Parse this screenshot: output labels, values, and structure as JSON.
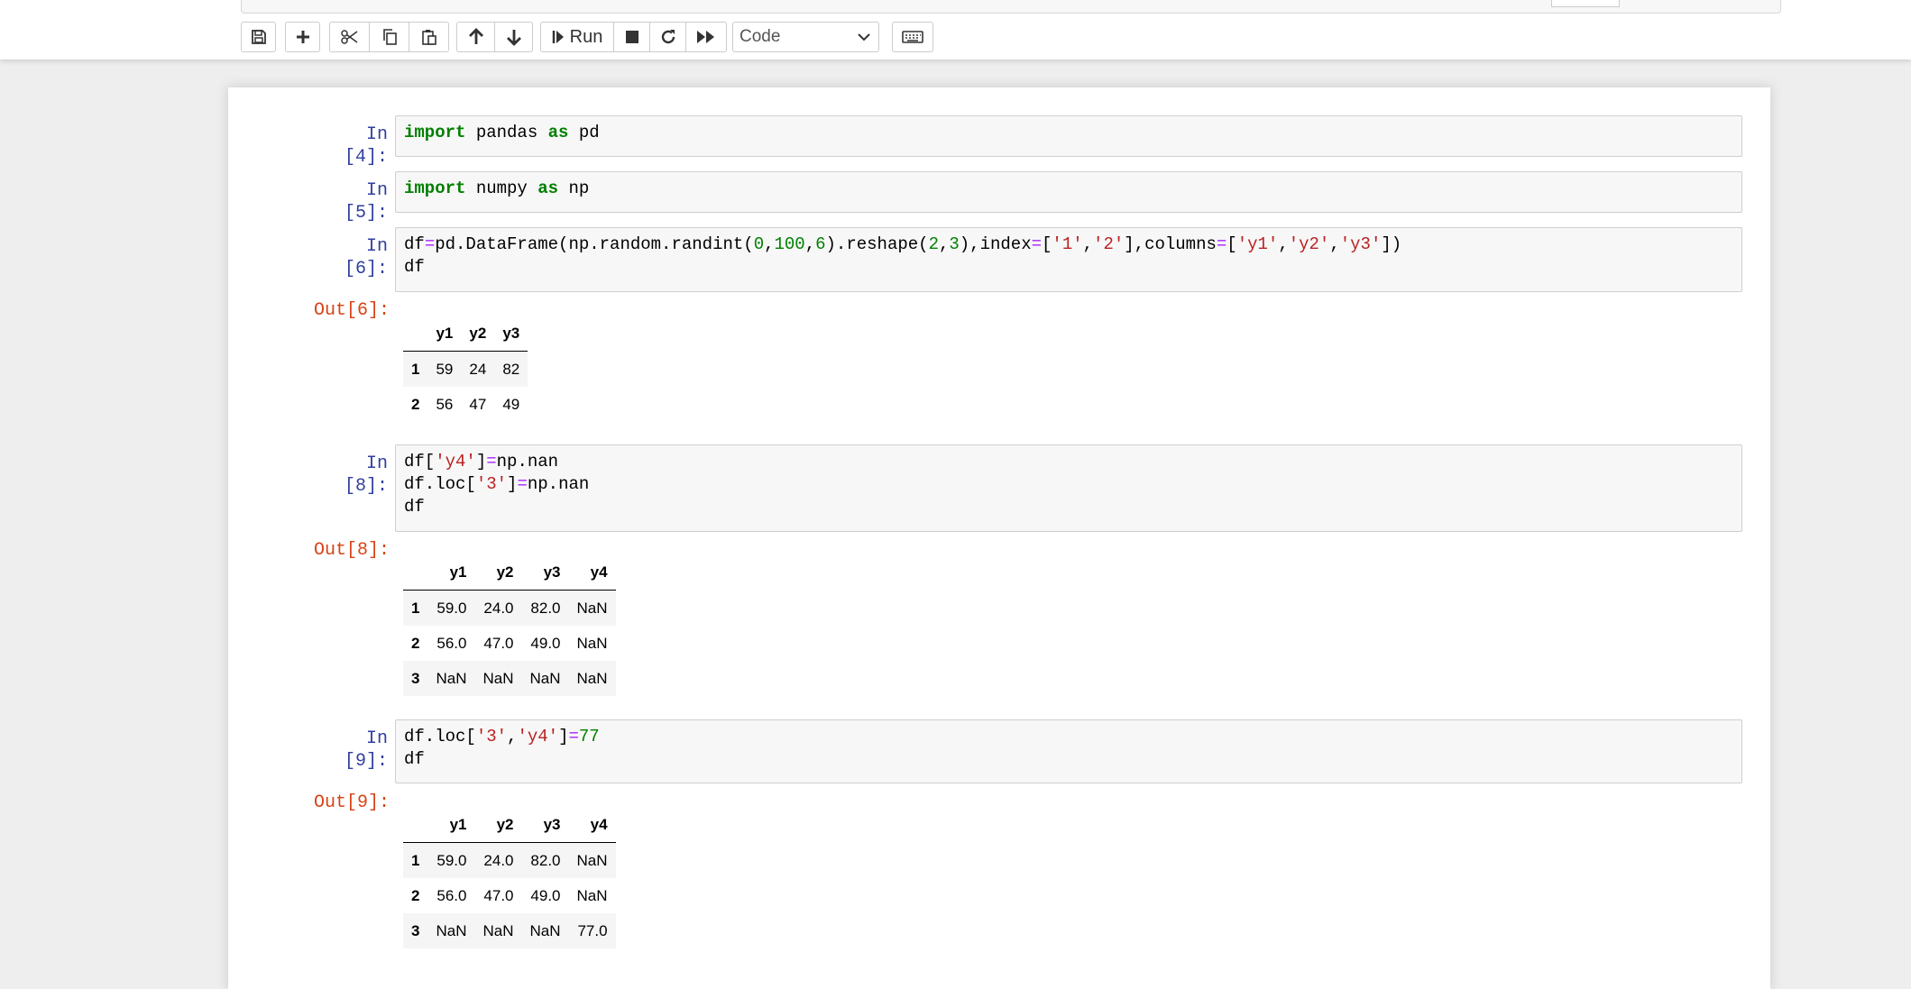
{
  "toolbar": {
    "run_label": "Run",
    "cell_type": "Code",
    "buttons": [
      "save-icon",
      "plus-icon",
      "scissors-icon",
      "copy-icon",
      "paste-icon",
      "arrow-up-icon",
      "arrow-down-icon",
      "step-forward-icon",
      "stop-icon",
      "refresh-icon",
      "fast-forward-icon",
      "keyboard-icon"
    ]
  },
  "cells": {
    "c4": {
      "prompt": "In [4]:"
    },
    "c5": {
      "prompt": "In [5]:"
    },
    "c6": {
      "prompt": "In [6]:",
      "out_prompt": "Out[6]:"
    },
    "c8": {
      "prompt": "In [8]:",
      "out_prompt": "Out[8]:"
    },
    "c9": {
      "prompt": "In [9]:",
      "out_prompt": "Out[9]:"
    }
  },
  "code": {
    "c4": [
      [
        [
          "kw",
          "import"
        ],
        [
          "t",
          " pandas "
        ],
        [
          "kw",
          "as"
        ],
        [
          "t",
          " pd"
        ]
      ]
    ],
    "c5": [
      [
        [
          "kw",
          "import"
        ],
        [
          "t",
          " numpy "
        ],
        [
          "kw",
          "as"
        ],
        [
          "t",
          " np"
        ]
      ]
    ],
    "c6": [
      [
        [
          "t",
          "df"
        ],
        [
          "op",
          "="
        ],
        [
          "t",
          "pd.DataFrame(np.random.randint("
        ],
        [
          "num",
          "0"
        ],
        [
          "t",
          ","
        ],
        [
          "num",
          "100"
        ],
        [
          "t",
          ","
        ],
        [
          "num",
          "6"
        ],
        [
          "t",
          ").reshape("
        ],
        [
          "num",
          "2"
        ],
        [
          "t",
          ","
        ],
        [
          "num",
          "3"
        ],
        [
          "t",
          "),index"
        ],
        [
          "op",
          "="
        ],
        [
          "t",
          "["
        ],
        [
          "str",
          "'1'"
        ],
        [
          "t",
          ","
        ],
        [
          "str",
          "'2'"
        ],
        [
          "t",
          "],columns"
        ],
        [
          "op",
          "="
        ],
        [
          "t",
          "["
        ],
        [
          "str",
          "'y1'"
        ],
        [
          "t",
          ","
        ],
        [
          "str",
          "'y2'"
        ],
        [
          "t",
          ","
        ],
        [
          "str",
          "'y3'"
        ],
        [
          "t",
          "])"
        ]
      ],
      [
        [
          "t",
          "df"
        ]
      ]
    ],
    "c8": [
      [
        [
          "t",
          "df["
        ],
        [
          "str",
          "'y4'"
        ],
        [
          "t",
          "]"
        ],
        [
          "op",
          "="
        ],
        [
          "t",
          "np.nan"
        ]
      ],
      [
        [
          "t",
          "df.loc["
        ],
        [
          "str",
          "'3'"
        ],
        [
          "t",
          "]"
        ],
        [
          "op",
          "="
        ],
        [
          "t",
          "np.nan"
        ]
      ],
      [
        [
          "t",
          "df"
        ]
      ]
    ],
    "c9": [
      [
        [
          "t",
          "df.loc["
        ],
        [
          "str",
          "'3'"
        ],
        [
          "t",
          ","
        ],
        [
          "str",
          "'y4'"
        ],
        [
          "t",
          "]"
        ],
        [
          "op",
          "="
        ],
        [
          "num",
          "77"
        ]
      ],
      [
        [
          "t",
          "df"
        ]
      ]
    ]
  },
  "outputs": {
    "out6": {
      "columns": [
        "y1",
        "y2",
        "y3"
      ],
      "rows": [
        {
          "index": "1",
          "values": [
            "59",
            "24",
            "82"
          ]
        },
        {
          "index": "2",
          "values": [
            "56",
            "47",
            "49"
          ]
        }
      ]
    },
    "out8": {
      "columns": [
        "y1",
        "y2",
        "y3",
        "y4"
      ],
      "rows": [
        {
          "index": "1",
          "values": [
            "59.0",
            "24.0",
            "82.0",
            "NaN"
          ]
        },
        {
          "index": "2",
          "values": [
            "56.0",
            "47.0",
            "49.0",
            "NaN"
          ]
        },
        {
          "index": "3",
          "values": [
            "NaN",
            "NaN",
            "NaN",
            "NaN"
          ]
        }
      ]
    },
    "out9": {
      "columns": [
        "y1",
        "y2",
        "y3",
        "y4"
      ],
      "rows": [
        {
          "index": "1",
          "values": [
            "59.0",
            "24.0",
            "82.0",
            "NaN"
          ]
        },
        {
          "index": "2",
          "values": [
            "56.0",
            "47.0",
            "49.0",
            "NaN"
          ]
        },
        {
          "index": "3",
          "values": [
            "NaN",
            "NaN",
            "NaN",
            "77.0"
          ]
        }
      ]
    }
  }
}
